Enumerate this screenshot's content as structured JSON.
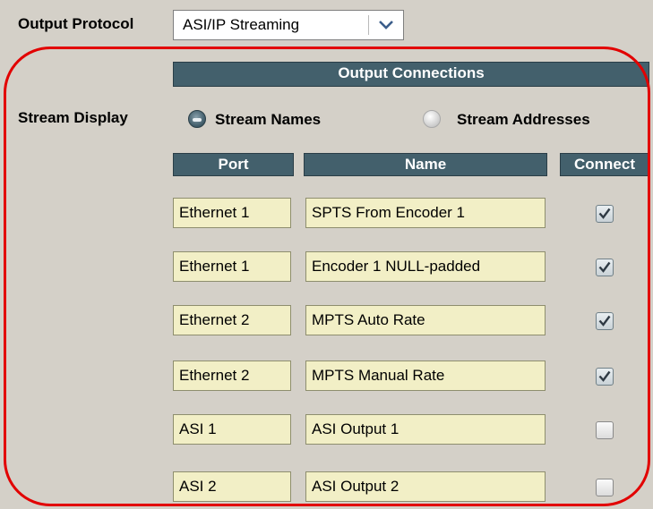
{
  "output_protocol": {
    "label": "Output Protocol",
    "selected": "ASI/IP Streaming"
  },
  "section_title": "Output Connections",
  "stream_display": {
    "label": "Stream Display",
    "options": [
      {
        "label": "Stream Names",
        "selected": true
      },
      {
        "label": "Stream Addresses",
        "selected": false
      }
    ]
  },
  "columns": {
    "port": "Port",
    "name": "Name",
    "connect": "Connect"
  },
  "rows": [
    {
      "port": "Ethernet 1",
      "name": "SPTS From Encoder 1",
      "connected": true
    },
    {
      "port": "Ethernet 1",
      "name": "Encoder 1 NULL-padded",
      "connected": true
    },
    {
      "port": "Ethernet 2",
      "name": "MPTS Auto Rate",
      "connected": true
    },
    {
      "port": "Ethernet 2",
      "name": "MPTS Manual Rate",
      "connected": true
    },
    {
      "port": "ASI 1",
      "name": "ASI Output 1",
      "connected": false
    },
    {
      "port": "ASI 2",
      "name": "ASI Output 2",
      "connected": false
    }
  ],
  "colors": {
    "header_bg": "#43606c",
    "field_bg": "#f2efc6",
    "highlight_frame": "#e20000",
    "panel_bg": "#d4d0c8"
  }
}
